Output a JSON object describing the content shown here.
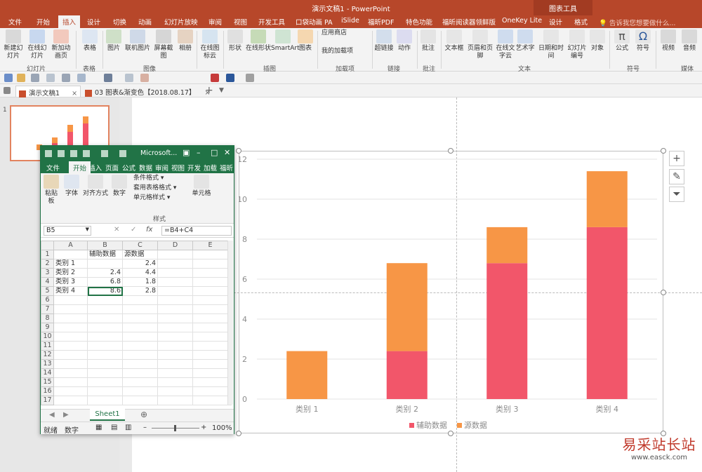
{
  "app": {
    "window_title": "演示文稿1 - PowerPoint",
    "context_group": "图表工具",
    "tell_me": "告诉我您想要做什么..."
  },
  "tabs": [
    "文件",
    "开始",
    "插入",
    "设计",
    "切换",
    "动画",
    "幻灯片放映",
    "审阅",
    "视图",
    "开发工具",
    "口袋动画 PA",
    "iSlide",
    "福昕PDF",
    "特色功能",
    "福昕阅读器领鲜版",
    "OneKey Lite",
    "设计",
    "格式"
  ],
  "ribbon": {
    "buttons": [
      "新建幻灯片",
      "在线幻灯片",
      "新加动画页",
      "表格",
      "图片",
      "联机图片",
      "屏幕截图",
      "相册",
      "在线图标云",
      "形状",
      "在线形状",
      "SmartArt",
      "图表",
      "应用商店",
      "我的加载项",
      "超链接",
      "动作",
      "批注",
      "文本框",
      "页眉和页脚",
      "在线文字云",
      "艺术字",
      "日期和时间",
      "幻灯片编号",
      "对象",
      "公式",
      "符号",
      "视频",
      "音频"
    ],
    "groups": [
      "幻灯片",
      "表格",
      "图像",
      "插图",
      "加载项",
      "链接",
      "批注",
      "文本",
      "符号",
      "媒体"
    ]
  },
  "doc_tabs": [
    {
      "label": "演示文稿1",
      "close": "×"
    },
    {
      "label": "03 图表&渐变色【2018.08.17】",
      "close": "×"
    }
  ],
  "slides": {
    "thumb_number": "1"
  },
  "excel": {
    "title": "Microsoft...",
    "tabs": [
      "文件",
      "开始",
      "插入",
      "页面",
      "公式",
      "数据",
      "审阅",
      "视图",
      "开发",
      "加载",
      "福昕"
    ],
    "ribbon_buttons": [
      "粘贴板",
      "字体",
      "对齐方式",
      "数字",
      "条件格式",
      "套用表格格式",
      "单元格样式",
      "单元格"
    ],
    "ribbon_group": "样式",
    "name_box": "B5",
    "formula": "=B4+C4",
    "columns": [
      "A",
      "B",
      "C",
      "D",
      "E"
    ],
    "rows": [
      [
        "",
        "辅助数据",
        "源数据",
        "",
        ""
      ],
      [
        "类别 1",
        "",
        "2.4",
        "",
        ""
      ],
      [
        "类别 2",
        "2.4",
        "4.4",
        "",
        ""
      ],
      [
        "类别 3",
        "6.8",
        "1.8",
        "",
        ""
      ],
      [
        "类别 4",
        "8.6",
        "2.8",
        "",
        ""
      ],
      [
        "",
        "",
        "",
        "",
        ""
      ],
      [
        "",
        "",
        "",
        "",
        ""
      ],
      [
        "",
        "",
        "",
        "",
        ""
      ],
      [
        "",
        "",
        "",
        "",
        ""
      ],
      [
        "",
        "",
        "",
        "",
        ""
      ],
      [
        "",
        "",
        "",
        "",
        ""
      ],
      [
        "",
        "",
        "",
        "",
        ""
      ],
      [
        "",
        "",
        "",
        "",
        ""
      ],
      [
        "",
        "",
        "",
        "",
        ""
      ],
      [
        "",
        "",
        "",
        "",
        ""
      ],
      [
        "",
        "",
        "",
        "",
        ""
      ],
      [
        "",
        "",
        "",
        "",
        ""
      ]
    ],
    "sheet_tab": "Sheet1",
    "status_ready": "就绪",
    "status_mode": "数字",
    "zoom": "100%"
  },
  "chart_data": {
    "type": "bar",
    "stacked": true,
    "categories": [
      "类别 1",
      "类别 2",
      "类别 3",
      "类别 4"
    ],
    "series": [
      {
        "name": "辅助数据",
        "values": [
          0,
          2.4,
          6.8,
          8.6
        ],
        "color": "#f2566a"
      },
      {
        "name": "源数据",
        "values": [
          2.4,
          4.4,
          1.8,
          2.8
        ],
        "color": "#f79646"
      }
    ],
    "ylim": [
      0,
      12
    ],
    "yticks": [
      0,
      2,
      4,
      6,
      8,
      10,
      12
    ],
    "grid": true,
    "legend": "bottom"
  },
  "watermark": {
    "title": "易采站长站",
    "url": "www.easck.com"
  }
}
